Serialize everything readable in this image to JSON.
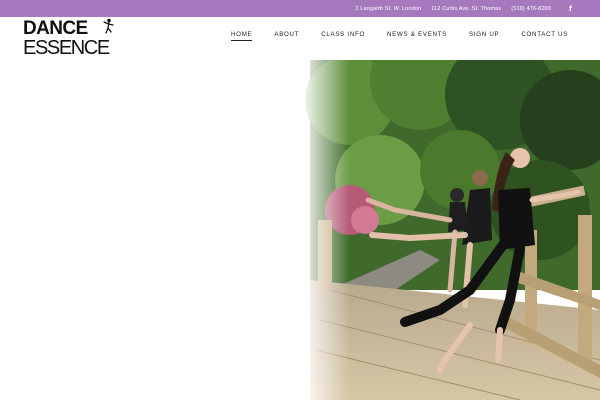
{
  "topbar": {
    "address_london": "2 Langarth St. W. London",
    "address_st_thomas": "112 Curtis Ave. St. Thomas",
    "phone": "(519) 476-8200",
    "facebook_icon": "f"
  },
  "brand": {
    "logo_line1": "DANCE",
    "logo_line2": "ESSENCE",
    "accent_color": "#a678be"
  },
  "nav": {
    "items": [
      {
        "label": "HOME",
        "active": true
      },
      {
        "label": "ABOUT"
      },
      {
        "label": "CLASS INFO"
      },
      {
        "label": "NEWS & EVENTS"
      },
      {
        "label": "SIGN UP"
      },
      {
        "label": "CONTACT US"
      }
    ]
  },
  "hero": {
    "image_icon": "dancers-at-barre-photo"
  }
}
